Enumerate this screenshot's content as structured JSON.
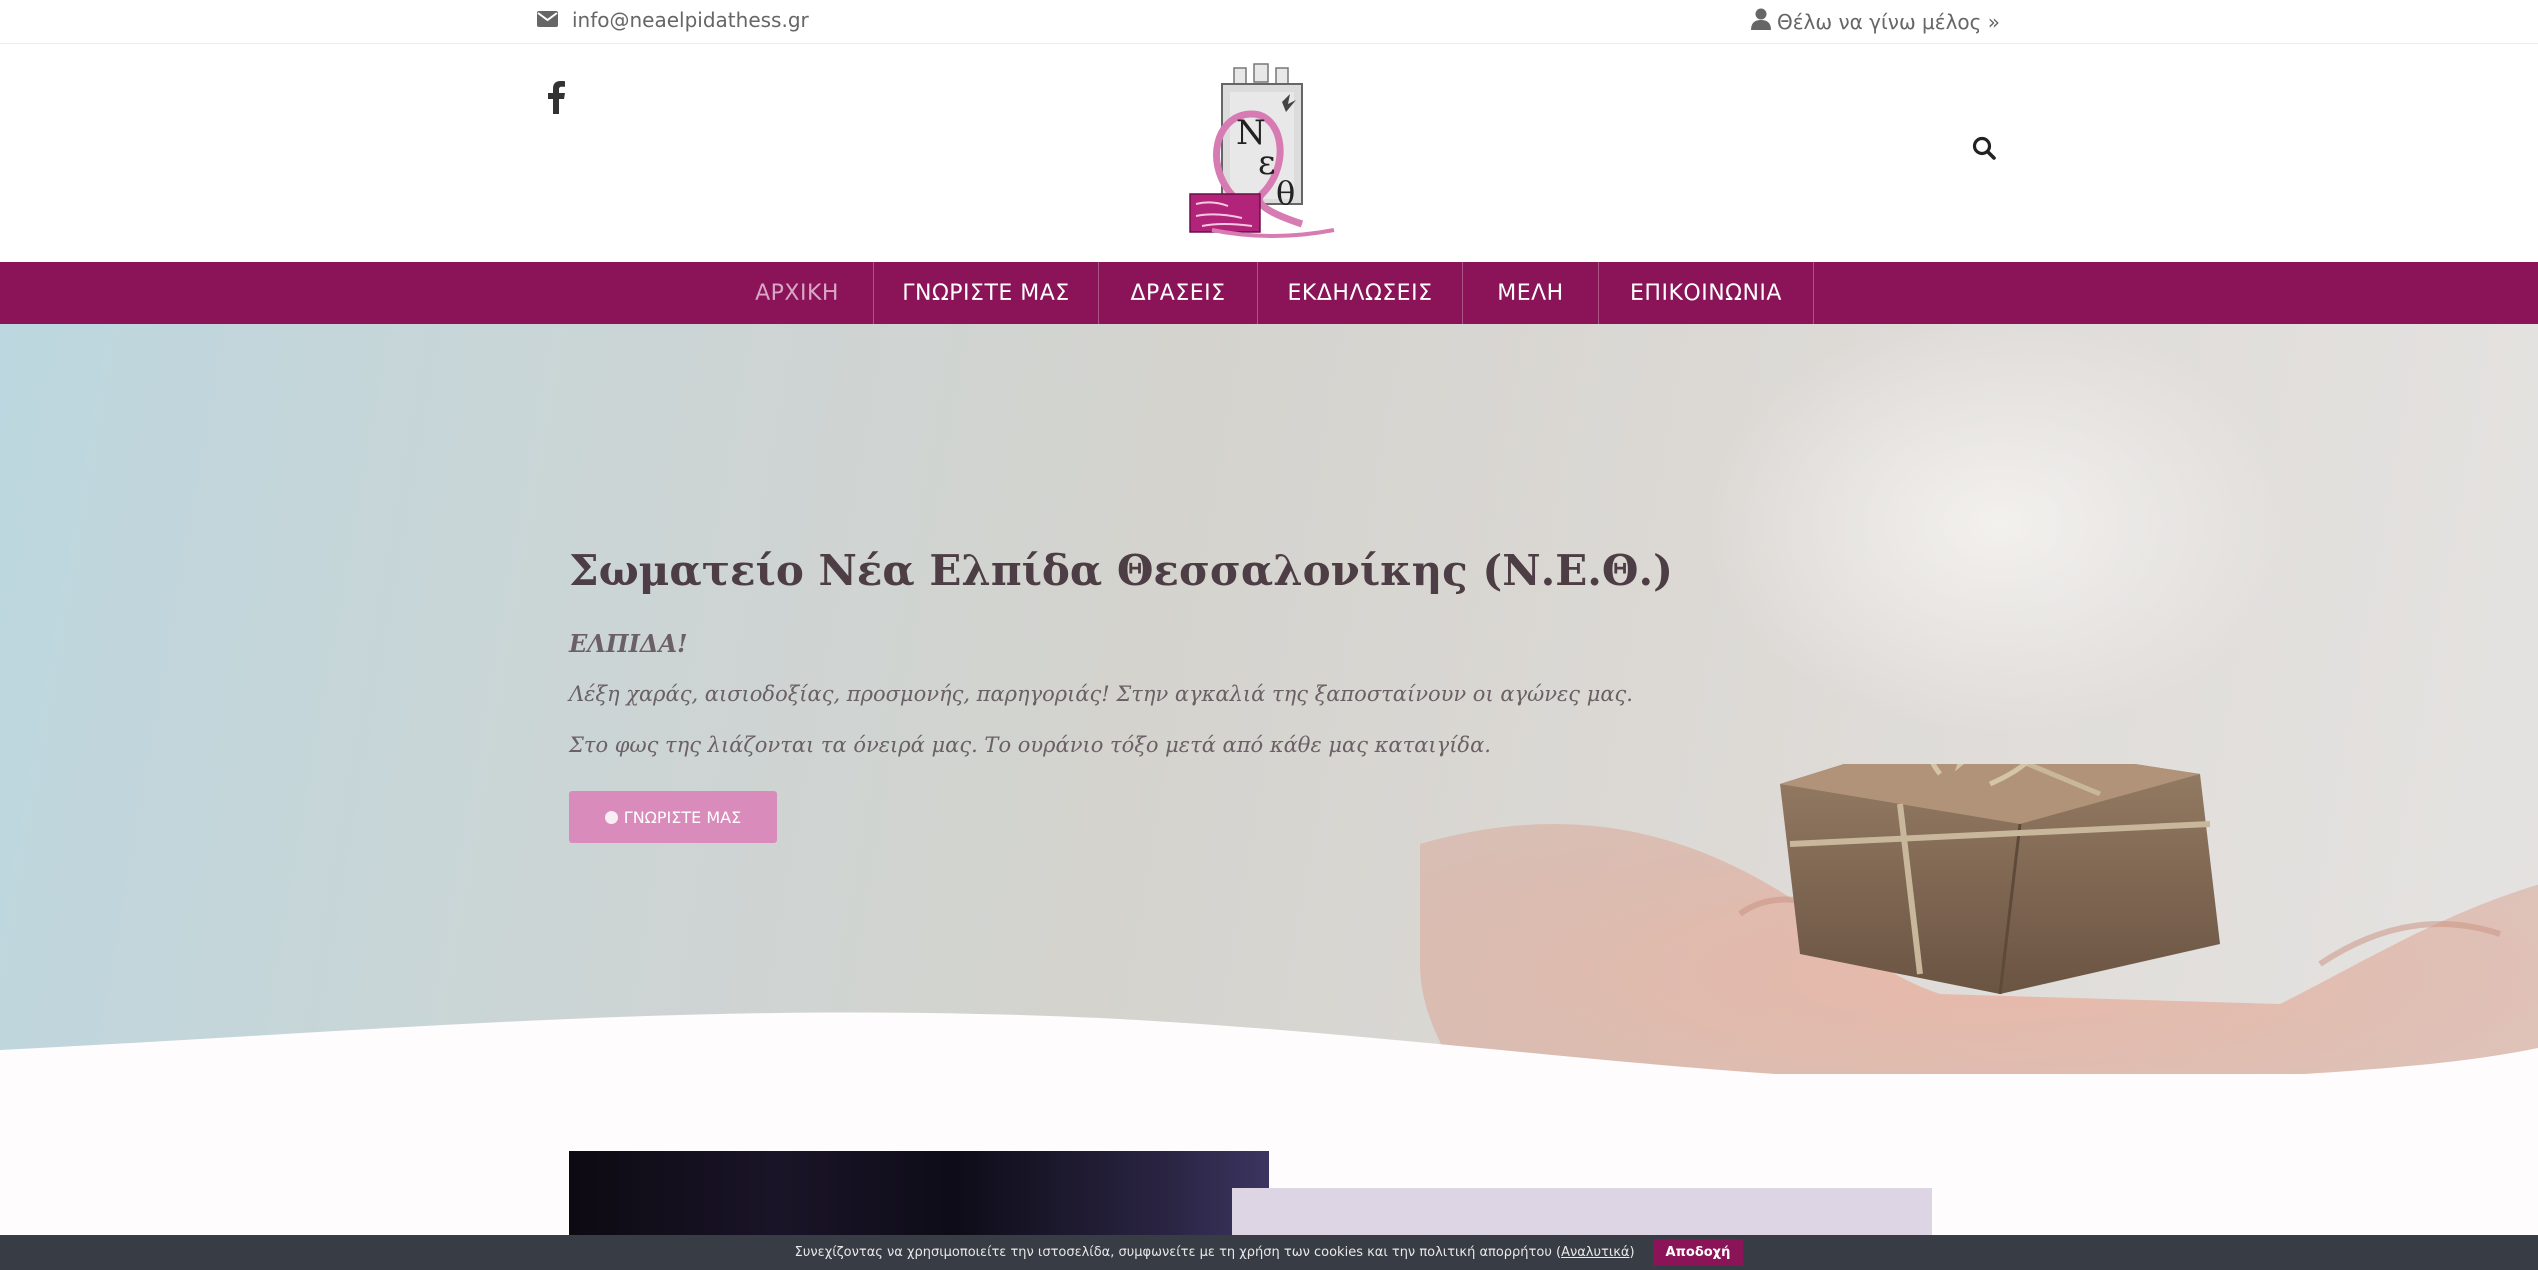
{
  "topbar": {
    "email": "info@neaelpidathess.gr",
    "member_link": "Θέλω να γίνω μέλος »"
  },
  "header": {
    "logo_letters": "ΝΕΘ"
  },
  "nav": {
    "items": [
      {
        "label": "ΑΡΧΙΚΗ",
        "active": true
      },
      {
        "label": "ΓΝΩΡΙΣΤΕ ΜΑΣ",
        "active": false
      },
      {
        "label": "ΔΡΑΣΕΙΣ",
        "active": false
      },
      {
        "label": "ΕΚΔΗΛΩΣΕΙΣ",
        "active": false
      },
      {
        "label": "ΜΕΛΗ",
        "active": false
      },
      {
        "label": "ΕΠΙΚΟΙΝΩΝΙΑ",
        "active": false
      }
    ]
  },
  "hero": {
    "title": "Σωματείο Νέα Ελπίδα Θεσσαλονίκης (Ν.Ε.Θ.)",
    "subtitle": "ΕΛΠΙΔΑ!",
    "line1": "Λέξη χαράς, αισιοδοξίας, προσμονής, παρηγοριάς! Στην αγκαλιά της ξαποσταίνουν οι αγώνες μας.",
    "line2": "Στο φως της λιάζονται τα όνειρά μας. Το ουράνιο τόξο μετά από κάθε μας καταιγίδα.",
    "button": "ΓΝΩΡΙΣΤΕ ΜΑΣ"
  },
  "cookie": {
    "text": "Συνεχίζοντας να χρησιμοποιείτε την ιστοσελίδα, συμφωνείτε με τη χρήση των cookies και την πολιτική απορρήτου (",
    "link": "Αναλυτικά",
    "text_end": ")",
    "accept": "Αποδοχή"
  },
  "colors": {
    "brand": "#8a1457",
    "button": "#d98bbb",
    "cookie_bg": "#383d45"
  },
  "icons": [
    "envelope-icon",
    "user-icon",
    "facebook-icon",
    "search-icon",
    "dot-icon"
  ]
}
